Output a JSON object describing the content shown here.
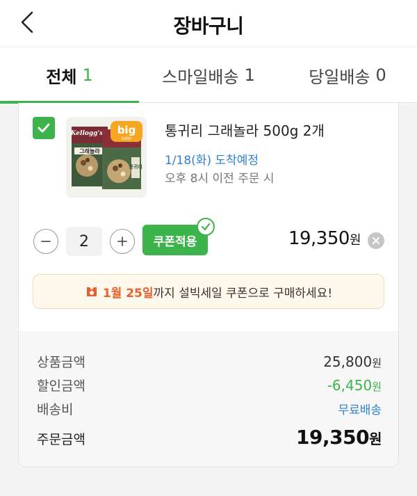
{
  "header": {
    "title": "장바구니",
    "back_icon": "chevron-left-icon"
  },
  "tabs": [
    {
      "label": "전체",
      "count": "1",
      "active": true
    },
    {
      "label": "스마일배송",
      "count": "1",
      "active": false
    },
    {
      "label": "당일배송",
      "count": "0",
      "active": false
    }
  ],
  "item": {
    "checked": true,
    "name": "통귀리 그래놀라 500g 2개",
    "delivery_date": "1/18(화) 도착예정",
    "delivery_condition": "오후 8시 이전 주문 시",
    "quantity": "2",
    "coupon_label": "쿠폰적용",
    "price": "19,350",
    "price_unit": "원",
    "image": {
      "brand_text": "Kellogg's",
      "badge_text": "big",
      "badge_sub": "sale",
      "product_text": "그래놀라",
      "pack_text": "통귀리"
    }
  },
  "promo": {
    "icon": "gift-icon",
    "highlight": "1월 25일",
    "text": "까지 설빅세일 쿠폰으로 구매하세요!"
  },
  "summary": {
    "product_label": "상품금액",
    "product_value": "25,800",
    "discount_label": "할인금액",
    "discount_value": "-6,450",
    "shipping_label": "배송비",
    "shipping_value": "무료배송",
    "total_label": "주문금액",
    "total_value": "19,350",
    "unit": "원"
  },
  "colors": {
    "accent": "#3cb44b",
    "link": "#2f80d1",
    "promo": "#e9612e"
  }
}
